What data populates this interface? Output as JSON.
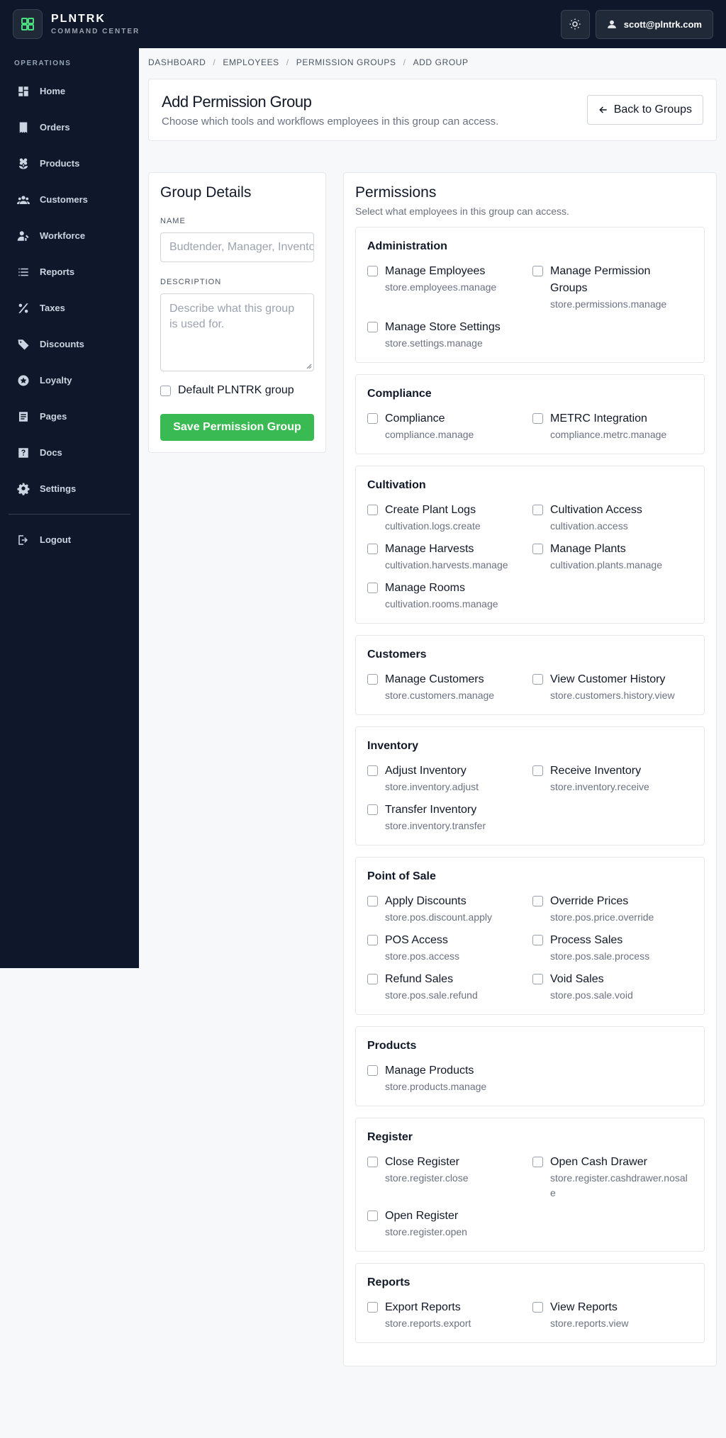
{
  "header": {
    "brand_name": "PLNTRK",
    "brand_sub": "COMMAND CENTER",
    "user_email": "scott@plntrk.com"
  },
  "sidebar": {
    "section": "OPERATIONS",
    "items": [
      {
        "label": "Home",
        "icon": "dashboard-icon"
      },
      {
        "label": "Orders",
        "icon": "receipt-icon"
      },
      {
        "label": "Products",
        "icon": "flower-icon"
      },
      {
        "label": "Customers",
        "icon": "people-icon"
      },
      {
        "label": "Workforce",
        "icon": "workforce-icon"
      },
      {
        "label": "Reports",
        "icon": "list-icon"
      },
      {
        "label": "Taxes",
        "icon": "percent-icon"
      },
      {
        "label": "Discounts",
        "icon": "tag-icon"
      },
      {
        "label": "Loyalty",
        "icon": "star-badge-icon"
      },
      {
        "label": "Pages",
        "icon": "page-icon"
      },
      {
        "label": "Docs",
        "icon": "help-icon"
      },
      {
        "label": "Settings",
        "icon": "gear-icon"
      }
    ],
    "logout": "Logout"
  },
  "breadcrumb": [
    "DASHBOARD",
    "EMPLOYEES",
    "PERMISSION GROUPS",
    "ADD GROUP"
  ],
  "page": {
    "title": "Add Permission Group",
    "subtitle": "Choose which tools and workflows employees in this group can access.",
    "back_label": "Back to Groups"
  },
  "details": {
    "title": "Group Details",
    "name_label": "NAME",
    "name_placeholder": "Budtender, Manager, Inventory",
    "description_label": "DESCRIPTION",
    "description_placeholder": "Describe what this group is used for.",
    "default_label": "Default PLNTRK group",
    "save_label": "Save Permission Group"
  },
  "permissions": {
    "title": "Permissions",
    "subtitle": "Select what employees in this group can access.",
    "groups": [
      {
        "title": "Administration",
        "items": [
          {
            "name": "Manage Employees",
            "key": "store.employees.manage"
          },
          {
            "name": "Manage Permission Groups",
            "key": "store.permissions.manage"
          },
          {
            "name": "Manage Store Settings",
            "key": "store.settings.manage"
          }
        ]
      },
      {
        "title": "Compliance",
        "items": [
          {
            "name": "Compliance",
            "key": "compliance.manage"
          },
          {
            "name": "METRC Integration",
            "key": "compliance.metrc.manage"
          }
        ]
      },
      {
        "title": "Cultivation",
        "items": [
          {
            "name": "Create Plant Logs",
            "key": "cultivation.logs.create"
          },
          {
            "name": "Cultivation Access",
            "key": "cultivation.access"
          },
          {
            "name": "Manage Harvests",
            "key": "cultivation.harvests.manage"
          },
          {
            "name": "Manage Plants",
            "key": "cultivation.plants.manage"
          },
          {
            "name": "Manage Rooms",
            "key": "cultivation.rooms.manage"
          }
        ]
      },
      {
        "title": "Customers",
        "items": [
          {
            "name": "Manage Customers",
            "key": "store.customers.manage"
          },
          {
            "name": "View Customer History",
            "key": "store.customers.history.view"
          }
        ]
      },
      {
        "title": "Inventory",
        "items": [
          {
            "name": "Adjust Inventory",
            "key": "store.inventory.adjust"
          },
          {
            "name": "Receive Inventory",
            "key": "store.inventory.receive"
          },
          {
            "name": "Transfer Inventory",
            "key": "store.inventory.transfer"
          }
        ]
      },
      {
        "title": "Point of Sale",
        "items": [
          {
            "name": "Apply Discounts",
            "key": "store.pos.discount.apply"
          },
          {
            "name": "Override Prices",
            "key": "store.pos.price.override"
          },
          {
            "name": "POS Access",
            "key": "store.pos.access"
          },
          {
            "name": "Process Sales",
            "key": "store.pos.sale.process"
          },
          {
            "name": "Refund Sales",
            "key": "store.pos.sale.refund"
          },
          {
            "name": "Void Sales",
            "key": "store.pos.sale.void"
          }
        ]
      },
      {
        "title": "Products",
        "items": [
          {
            "name": "Manage Products",
            "key": "store.products.manage"
          }
        ]
      },
      {
        "title": "Register",
        "items": [
          {
            "name": "Close Register",
            "key": "store.register.close"
          },
          {
            "name": "Open Cash Drawer",
            "key": "store.register.cashdrawer.nosale"
          },
          {
            "name": "Open Register",
            "key": "store.register.open"
          }
        ]
      },
      {
        "title": "Reports",
        "items": [
          {
            "name": "Export Reports",
            "key": "store.reports.export"
          },
          {
            "name": "View Reports",
            "key": "store.reports.view"
          }
        ]
      }
    ]
  }
}
